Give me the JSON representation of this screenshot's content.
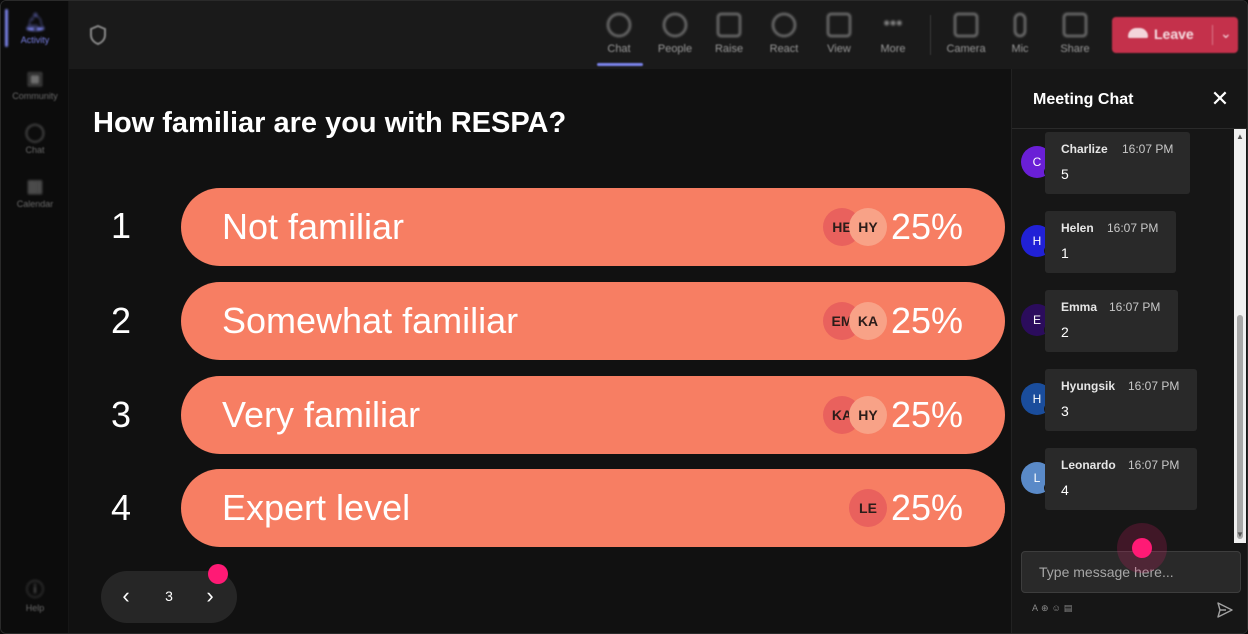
{
  "rail": {
    "items": [
      {
        "label": "Activity",
        "icon": "bell-icon",
        "active": true
      },
      {
        "label": "Community",
        "icon": "community-icon"
      },
      {
        "label": "Chat",
        "icon": "chat-icon"
      },
      {
        "label": "Calendar",
        "icon": "calendar-icon"
      }
    ],
    "help_label": "Help"
  },
  "toolbar": {
    "items": [
      {
        "label": "Chat",
        "icon": "chat-icon",
        "active": true
      },
      {
        "label": "People",
        "icon": "people-icon"
      },
      {
        "label": "Raise",
        "icon": "hand-icon"
      },
      {
        "label": "React",
        "icon": "smile-icon"
      },
      {
        "label": "View",
        "icon": "grid-icon"
      },
      {
        "label": "More",
        "icon": "more-icon"
      },
      {
        "label": "Camera",
        "icon": "camera-off-icon"
      },
      {
        "label": "Mic",
        "icon": "mic-icon"
      },
      {
        "label": "Share",
        "icon": "share-icon"
      }
    ],
    "leave_label": "Leave",
    "leave_color": "#c4314b"
  },
  "poll": {
    "question": "How familiar are you with RESPA?",
    "bar_color": "#f77e63",
    "options": [
      {
        "number": "1",
        "label": "Not familiar",
        "percent": "25%",
        "avatars": [
          "HE",
          "HY"
        ]
      },
      {
        "number": "2",
        "label": "Somewhat familiar",
        "percent": "25%",
        "avatars": [
          "EM",
          "KA"
        ]
      },
      {
        "number": "3",
        "label": "Very familiar",
        "percent": "25%",
        "avatars": [
          "KA",
          "HY"
        ]
      },
      {
        "number": "4",
        "label": "Expert level",
        "percent": "25%",
        "avatars": [
          "LE"
        ]
      }
    ],
    "pager": {
      "page": "3"
    }
  },
  "chat": {
    "title": "Meeting Chat",
    "messages": [
      {
        "initial": "C",
        "name": "Charlize",
        "time": "16:07 PM",
        "text": "5",
        "avatar_color": "#6a1fd6"
      },
      {
        "initial": "H",
        "name": "Helen",
        "time": "16:07 PM",
        "text": "1",
        "avatar_color": "#2121d6"
      },
      {
        "initial": "E",
        "name": "Emma",
        "time": "16:07 PM",
        "text": "2",
        "avatar_color": "#2b0c5c"
      },
      {
        "initial": "H",
        "name": "Hyungsik",
        "time": "16:07 PM",
        "text": "3",
        "avatar_color": "#1a4d9c"
      },
      {
        "initial": "L",
        "name": "Leonardo",
        "time": "16:07 PM",
        "text": "4",
        "avatar_color": "#5a8ac8"
      }
    ],
    "compose_placeholder": "Type message here..."
  },
  "accent_color": "#7b83eb",
  "pointer_color": "#ff1a75"
}
